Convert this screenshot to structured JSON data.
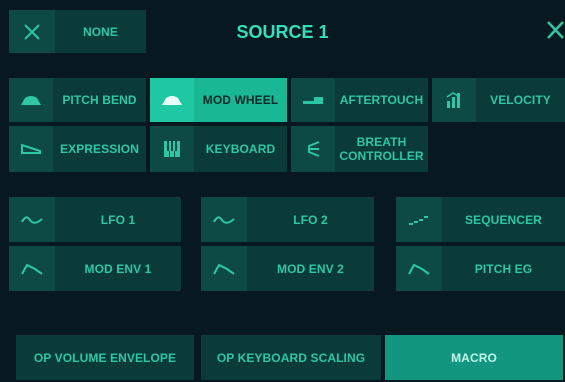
{
  "header": {
    "title": "SOURCE 1",
    "none_label": "NONE"
  },
  "icons": {
    "none": "x-icon",
    "close": "close-icon"
  },
  "row1": [
    {
      "label": "PITCH BEND",
      "icon": "pitch-bend-icon",
      "selected": false
    },
    {
      "label": "MOD WHEEL",
      "icon": "mod-wheel-icon",
      "selected": true
    },
    {
      "label": "AFTERTOUCH",
      "icon": "aftertouch-icon",
      "selected": false
    },
    {
      "label": "VELOCITY",
      "icon": "velocity-icon",
      "selected": false
    }
  ],
  "row2": [
    {
      "label": "EXPRESSION",
      "icon": "expression-icon",
      "selected": false
    },
    {
      "label": "KEYBOARD",
      "icon": "keyboard-icon",
      "selected": false
    },
    {
      "label": "BREATH CONTROLLER",
      "line1": "BREATH",
      "line2": "CONTROLLER",
      "icon": "breath-controller-icon",
      "selected": false
    }
  ],
  "lfo_row": [
    {
      "label": "LFO 1",
      "icon": "lfo-icon"
    },
    {
      "label": "LFO 2",
      "icon": "lfo-icon"
    },
    {
      "label": "SEQUENCER",
      "icon": "sequencer-icon"
    }
  ],
  "env_row": [
    {
      "label": "MOD ENV 1",
      "icon": "envelope-icon"
    },
    {
      "label": "MOD ENV 2",
      "icon": "envelope-icon"
    },
    {
      "label": "PITCH EG",
      "icon": "envelope-icon"
    }
  ],
  "bottom_tabs": [
    {
      "label": "OP VOLUME ENVELOPE",
      "selected": false
    },
    {
      "label": "OP KEYBOARD SCALING",
      "selected": false
    },
    {
      "label": "MACRO",
      "selected": true
    }
  ],
  "colors": {
    "accent": "#2ec7a6",
    "selected": "#1fc7a2",
    "button_bg": "#0b3b39",
    "background": "#081820"
  }
}
